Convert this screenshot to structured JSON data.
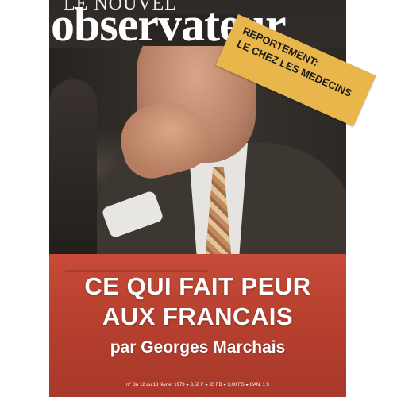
{
  "magazine": {
    "masthead_small": "LE NOUVEL",
    "masthead": "observateur"
  },
  "banner": {
    "line1": "REPORTEMENT:",
    "line2": "LE CHEZ LES MEDECINS"
  },
  "headline": {
    "line1": "CE QUI FAIT PEUR",
    "line2": "AUX FRANCAIS",
    "byline": "par Georges Marchais"
  },
  "footer": {
    "text": "n° Du 12 au 18 février 1973 ● 3,50 F ● 35 FB ● 3,00 FS ● CAN. 1 $"
  },
  "colors": {
    "seat_red": "#c74b38",
    "banner_yellow": "#e8b64a",
    "text_white": "#ffffff"
  }
}
